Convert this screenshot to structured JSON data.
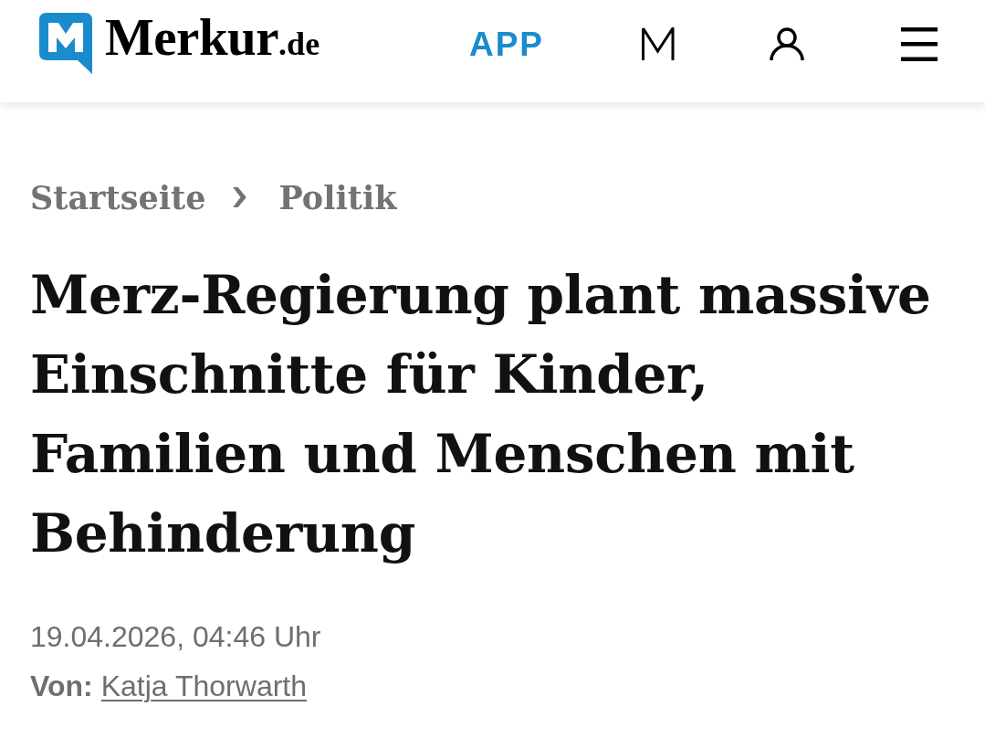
{
  "header": {
    "logo": {
      "name": "Merkur",
      "suffix": ".de"
    },
    "app_link": "APP"
  },
  "breadcrumb": [
    {
      "label": "Startseite"
    },
    {
      "label": "Politik"
    }
  ],
  "article": {
    "headline": "Merz-Regierung plant massive Einschnitte für Kinder, Familien und Menschen mit Behinderung",
    "published": "19.04.2026, 04:46 Uhr",
    "byline": {
      "label": "Von:",
      "author": "Katja Thorwarth"
    }
  }
}
